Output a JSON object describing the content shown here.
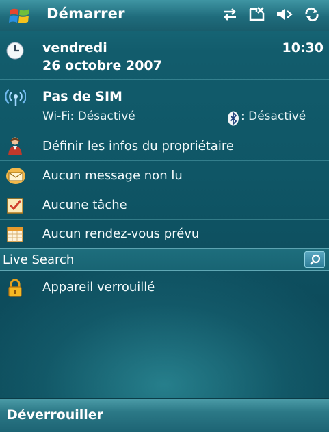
{
  "titlebar": {
    "start_label": "Démarrer",
    "icons": [
      "connectivity-arrows-icon",
      "no-signal-icon",
      "speaker-muted-icon",
      "activesync-icon"
    ]
  },
  "datetime": {
    "day": "vendredi",
    "date": "26 octobre 2007",
    "time": "10:30"
  },
  "wireless": {
    "title": "Pas de SIM",
    "wifi": "Wi-Fi: Désactivé",
    "bluetooth": ": Désactivé"
  },
  "items": [
    {
      "icon": "owner-person-icon",
      "label": "Définir les infos du propriétaire"
    },
    {
      "icon": "envelope-icon",
      "label": "Aucun message non lu"
    },
    {
      "icon": "task-checkbox-icon",
      "label": "Aucune tâche"
    },
    {
      "icon": "calendar-icon",
      "label": "Aucun rendez-vous prévu"
    }
  ],
  "search": {
    "value": "Live Search"
  },
  "lock": {
    "icon": "padlock-icon",
    "label": "Appareil verrouillé"
  },
  "softkey": {
    "left_label": "Déverrouiller"
  },
  "colors": {
    "background": "#0f5666",
    "titlebar": "#1f6c7c",
    "accent": "#8fd0e0"
  }
}
